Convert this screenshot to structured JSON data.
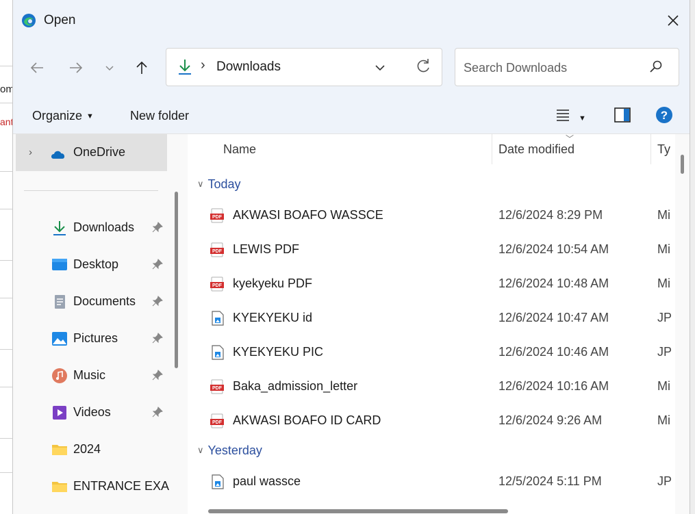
{
  "window": {
    "title": "Open"
  },
  "background": {
    "fragments": [
      "om",
      "ant"
    ]
  },
  "nav": {
    "back_icon": "arrow-left-icon",
    "forward_icon": "arrow-right-icon",
    "recent_icon": "chevron-down-icon",
    "up_icon": "arrow-up-icon",
    "breadcrumb": "Downloads",
    "refresh_icon": "refresh-icon"
  },
  "search": {
    "placeholder": "Search Downloads",
    "value": ""
  },
  "toolbar": {
    "organize_label": "Organize",
    "new_folder_label": "New folder",
    "view_icon": "list-view-icon",
    "preview_icon": "preview-pane-icon",
    "help_icon": "help-icon",
    "help_text": "?"
  },
  "sidebar": {
    "onedrive": "OneDrive",
    "items": [
      {
        "label": "Downloads",
        "icon": "download-icon",
        "pinned": true
      },
      {
        "label": "Desktop",
        "icon": "desktop-icon",
        "pinned": true
      },
      {
        "label": "Documents",
        "icon": "documents-icon",
        "pinned": true
      },
      {
        "label": "Pictures",
        "icon": "pictures-icon",
        "pinned": true
      },
      {
        "label": "Music",
        "icon": "music-icon",
        "pinned": true
      },
      {
        "label": "Videos",
        "icon": "videos-icon",
        "pinned": true
      },
      {
        "label": "2024",
        "icon": "folder-icon",
        "pinned": false
      },
      {
        "label": "ENTRANCE EXA",
        "icon": "folder-icon",
        "pinned": false
      }
    ]
  },
  "columns": {
    "name": "Name",
    "date": "Date modified",
    "type": "Ty"
  },
  "groups": {
    "today": {
      "label": "Today",
      "files": [
        {
          "name": "AKWASI BOAFO WASSCE",
          "date": "12/6/2024 8:29 PM",
          "type": "Mi",
          "icon": "pdf-icon"
        },
        {
          "name": "LEWIS PDF",
          "date": "12/6/2024 10:54 AM",
          "type": "Mi",
          "icon": "pdf-icon"
        },
        {
          "name": "kyekyeku PDF",
          "date": "12/6/2024 10:48 AM",
          "type": "Mi",
          "icon": "pdf-icon"
        },
        {
          "name": "KYEKYEKU id",
          "date": "12/6/2024 10:47 AM",
          "type": "JP",
          "icon": "image-file-icon"
        },
        {
          "name": "KYEKYEKU PIC",
          "date": "12/6/2024 10:46 AM",
          "type": "JP",
          "icon": "image-file-icon"
        },
        {
          "name": "Baka_admission_letter",
          "date": "12/6/2024 10:16 AM",
          "type": "Mi",
          "icon": "pdf-icon"
        },
        {
          "name": "AKWASI BOAFO ID CARD",
          "date": "12/6/2024 9:26 AM",
          "type": "Mi",
          "icon": "pdf-icon"
        }
      ]
    },
    "yesterday": {
      "label": "Yesterday",
      "files": [
        {
          "name": "paul wassce",
          "date": "12/5/2024 5:11 PM",
          "type": "JP",
          "icon": "image-file-icon"
        }
      ]
    }
  },
  "colors": {
    "accent": "#0078d4",
    "group_text": "#2c4f9e",
    "pdf_red": "#d32f2f"
  }
}
